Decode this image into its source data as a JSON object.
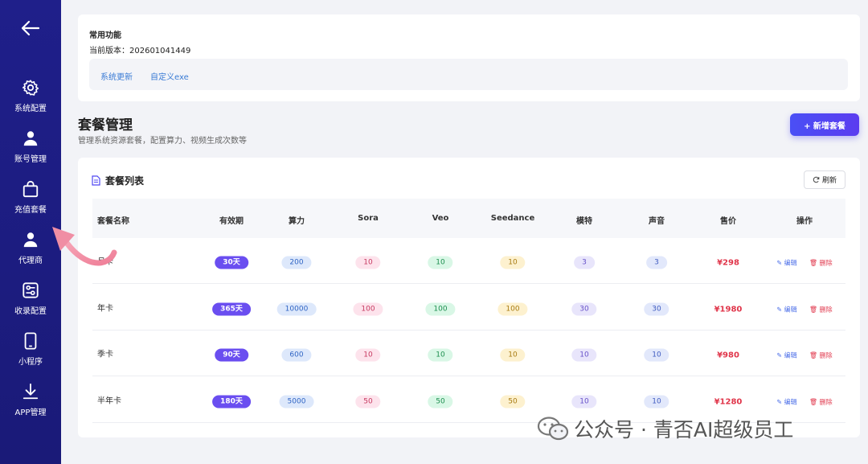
{
  "sidebar": {
    "items": [
      {
        "label": "系统配置",
        "icon": "gear-icon"
      },
      {
        "label": "账号管理",
        "icon": "user-icon"
      },
      {
        "label": "充值套餐",
        "icon": "shopping-bag-icon"
      },
      {
        "label": "代理商",
        "icon": "user-icon"
      },
      {
        "label": "收录配置",
        "icon": "sliders-icon"
      },
      {
        "label": "小程序",
        "icon": "phone-icon"
      },
      {
        "label": "APP管理",
        "icon": "download-icon"
      }
    ]
  },
  "common": {
    "title": "常用功能",
    "version": "当前版本：202601041449",
    "links": [
      "系统更新",
      "自定义exe"
    ]
  },
  "page": {
    "title": "套餐管理",
    "subtitle": "管理系统资源套餐，配置算力、视频生成次数等",
    "add_label": "+ 新增套餐"
  },
  "list": {
    "title": "套餐列表",
    "refresh_label": "刷新",
    "columns": [
      "套餐名称",
      "有效期",
      "算力",
      "Sora",
      "Veo",
      "Seedance",
      "模特",
      "声音",
      "售价",
      "操作"
    ],
    "edit_label": "编辑",
    "delete_label": "删除",
    "rows": [
      {
        "name": "月卡",
        "validity": "30天",
        "power": "200",
        "sora": "10",
        "veo": "10",
        "seedance": "10",
        "model": "3",
        "voice": "3",
        "price": "¥298"
      },
      {
        "name": "年卡",
        "validity": "365天",
        "power": "10000",
        "sora": "100",
        "veo": "100",
        "seedance": "100",
        "model": "30",
        "voice": "30",
        "price": "¥1980"
      },
      {
        "name": "季卡",
        "validity": "90天",
        "power": "600",
        "sora": "10",
        "veo": "10",
        "seedance": "10",
        "model": "10",
        "voice": "10",
        "price": "¥980"
      },
      {
        "name": "半年卡",
        "validity": "180天",
        "power": "5000",
        "sora": "50",
        "veo": "50",
        "seedance": "50",
        "model": "10",
        "voice": "10",
        "price": "¥1280"
      }
    ]
  },
  "watermark": "公众号 · 青否AI超级员工",
  "colors": {
    "sidebar": "#1f1f8a",
    "accent": "#5048f2",
    "price": "#e0354a"
  }
}
